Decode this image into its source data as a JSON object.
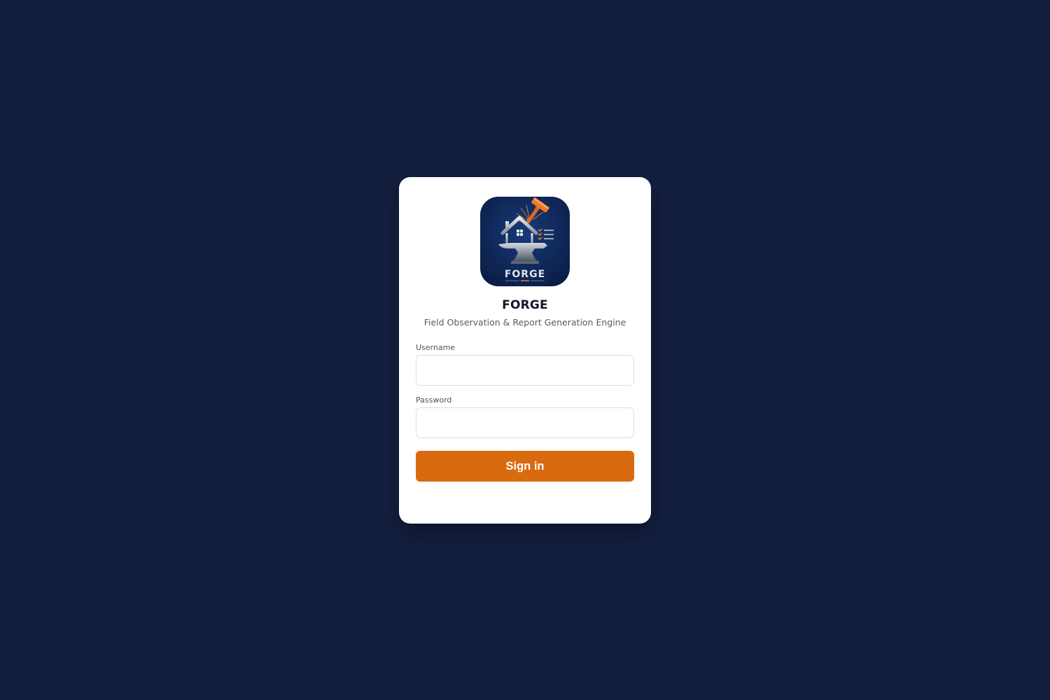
{
  "app": {
    "title": "FORGE",
    "subtitle": "Field Observation & Report Generation Engine",
    "logo_text": "FORGE",
    "logo_icon": "house-anvil-hammer-logo"
  },
  "form": {
    "username_label": "Username",
    "username_value": "",
    "username_placeholder": "",
    "password_label": "Password",
    "password_value": "",
    "password_placeholder": "",
    "submit_label": "Sign in"
  },
  "colors": {
    "page_background": "#141f3f",
    "card_background": "#ffffff",
    "accent": "#da6a10",
    "logo_background": "#0d2452"
  }
}
